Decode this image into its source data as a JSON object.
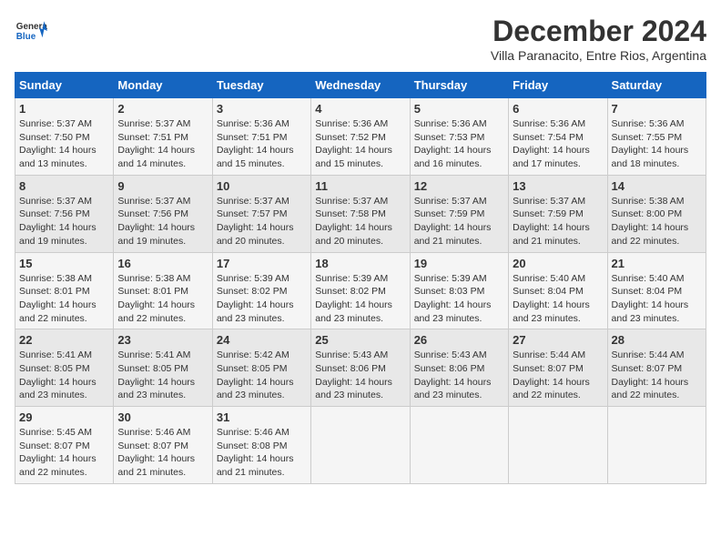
{
  "header": {
    "logo_general": "General",
    "logo_blue": "Blue",
    "month_title": "December 2024",
    "subtitle": "Villa Paranacito, Entre Rios, Argentina"
  },
  "weekdays": [
    "Sunday",
    "Monday",
    "Tuesday",
    "Wednesday",
    "Thursday",
    "Friday",
    "Saturday"
  ],
  "weeks": [
    [
      {
        "day": "1",
        "sunrise": "Sunrise: 5:37 AM",
        "sunset": "Sunset: 7:50 PM",
        "daylight": "Daylight: 14 hours and 13 minutes."
      },
      {
        "day": "2",
        "sunrise": "Sunrise: 5:37 AM",
        "sunset": "Sunset: 7:51 PM",
        "daylight": "Daylight: 14 hours and 14 minutes."
      },
      {
        "day": "3",
        "sunrise": "Sunrise: 5:36 AM",
        "sunset": "Sunset: 7:51 PM",
        "daylight": "Daylight: 14 hours and 15 minutes."
      },
      {
        "day": "4",
        "sunrise": "Sunrise: 5:36 AM",
        "sunset": "Sunset: 7:52 PM",
        "daylight": "Daylight: 14 hours and 15 minutes."
      },
      {
        "day": "5",
        "sunrise": "Sunrise: 5:36 AM",
        "sunset": "Sunset: 7:53 PM",
        "daylight": "Daylight: 14 hours and 16 minutes."
      },
      {
        "day": "6",
        "sunrise": "Sunrise: 5:36 AM",
        "sunset": "Sunset: 7:54 PM",
        "daylight": "Daylight: 14 hours and 17 minutes."
      },
      {
        "day": "7",
        "sunrise": "Sunrise: 5:36 AM",
        "sunset": "Sunset: 7:55 PM",
        "daylight": "Daylight: 14 hours and 18 minutes."
      }
    ],
    [
      {
        "day": "8",
        "sunrise": "Sunrise: 5:37 AM",
        "sunset": "Sunset: 7:56 PM",
        "daylight": "Daylight: 14 hours and 19 minutes."
      },
      {
        "day": "9",
        "sunrise": "Sunrise: 5:37 AM",
        "sunset": "Sunset: 7:56 PM",
        "daylight": "Daylight: 14 hours and 19 minutes."
      },
      {
        "day": "10",
        "sunrise": "Sunrise: 5:37 AM",
        "sunset": "Sunset: 7:57 PM",
        "daylight": "Daylight: 14 hours and 20 minutes."
      },
      {
        "day": "11",
        "sunrise": "Sunrise: 5:37 AM",
        "sunset": "Sunset: 7:58 PM",
        "daylight": "Daylight: 14 hours and 20 minutes."
      },
      {
        "day": "12",
        "sunrise": "Sunrise: 5:37 AM",
        "sunset": "Sunset: 7:59 PM",
        "daylight": "Daylight: 14 hours and 21 minutes."
      },
      {
        "day": "13",
        "sunrise": "Sunrise: 5:37 AM",
        "sunset": "Sunset: 7:59 PM",
        "daylight": "Daylight: 14 hours and 21 minutes."
      },
      {
        "day": "14",
        "sunrise": "Sunrise: 5:38 AM",
        "sunset": "Sunset: 8:00 PM",
        "daylight": "Daylight: 14 hours and 22 minutes."
      }
    ],
    [
      {
        "day": "15",
        "sunrise": "Sunrise: 5:38 AM",
        "sunset": "Sunset: 8:01 PM",
        "daylight": "Daylight: 14 hours and 22 minutes."
      },
      {
        "day": "16",
        "sunrise": "Sunrise: 5:38 AM",
        "sunset": "Sunset: 8:01 PM",
        "daylight": "Daylight: 14 hours and 22 minutes."
      },
      {
        "day": "17",
        "sunrise": "Sunrise: 5:39 AM",
        "sunset": "Sunset: 8:02 PM",
        "daylight": "Daylight: 14 hours and 23 minutes."
      },
      {
        "day": "18",
        "sunrise": "Sunrise: 5:39 AM",
        "sunset": "Sunset: 8:02 PM",
        "daylight": "Daylight: 14 hours and 23 minutes."
      },
      {
        "day": "19",
        "sunrise": "Sunrise: 5:39 AM",
        "sunset": "Sunset: 8:03 PM",
        "daylight": "Daylight: 14 hours and 23 minutes."
      },
      {
        "day": "20",
        "sunrise": "Sunrise: 5:40 AM",
        "sunset": "Sunset: 8:04 PM",
        "daylight": "Daylight: 14 hours and 23 minutes."
      },
      {
        "day": "21",
        "sunrise": "Sunrise: 5:40 AM",
        "sunset": "Sunset: 8:04 PM",
        "daylight": "Daylight: 14 hours and 23 minutes."
      }
    ],
    [
      {
        "day": "22",
        "sunrise": "Sunrise: 5:41 AM",
        "sunset": "Sunset: 8:05 PM",
        "daylight": "Daylight: 14 hours and 23 minutes."
      },
      {
        "day": "23",
        "sunrise": "Sunrise: 5:41 AM",
        "sunset": "Sunset: 8:05 PM",
        "daylight": "Daylight: 14 hours and 23 minutes."
      },
      {
        "day": "24",
        "sunrise": "Sunrise: 5:42 AM",
        "sunset": "Sunset: 8:05 PM",
        "daylight": "Daylight: 14 hours and 23 minutes."
      },
      {
        "day": "25",
        "sunrise": "Sunrise: 5:43 AM",
        "sunset": "Sunset: 8:06 PM",
        "daylight": "Daylight: 14 hours and 23 minutes."
      },
      {
        "day": "26",
        "sunrise": "Sunrise: 5:43 AM",
        "sunset": "Sunset: 8:06 PM",
        "daylight": "Daylight: 14 hours and 23 minutes."
      },
      {
        "day": "27",
        "sunrise": "Sunrise: 5:44 AM",
        "sunset": "Sunset: 8:07 PM",
        "daylight": "Daylight: 14 hours and 22 minutes."
      },
      {
        "day": "28",
        "sunrise": "Sunrise: 5:44 AM",
        "sunset": "Sunset: 8:07 PM",
        "daylight": "Daylight: 14 hours and 22 minutes."
      }
    ],
    [
      {
        "day": "29",
        "sunrise": "Sunrise: 5:45 AM",
        "sunset": "Sunset: 8:07 PM",
        "daylight": "Daylight: 14 hours and 22 minutes."
      },
      {
        "day": "30",
        "sunrise": "Sunrise: 5:46 AM",
        "sunset": "Sunset: 8:07 PM",
        "daylight": "Daylight: 14 hours and 21 minutes."
      },
      {
        "day": "31",
        "sunrise": "Sunrise: 5:46 AM",
        "sunset": "Sunset: 8:08 PM",
        "daylight": "Daylight: 14 hours and 21 minutes."
      },
      null,
      null,
      null,
      null
    ]
  ]
}
